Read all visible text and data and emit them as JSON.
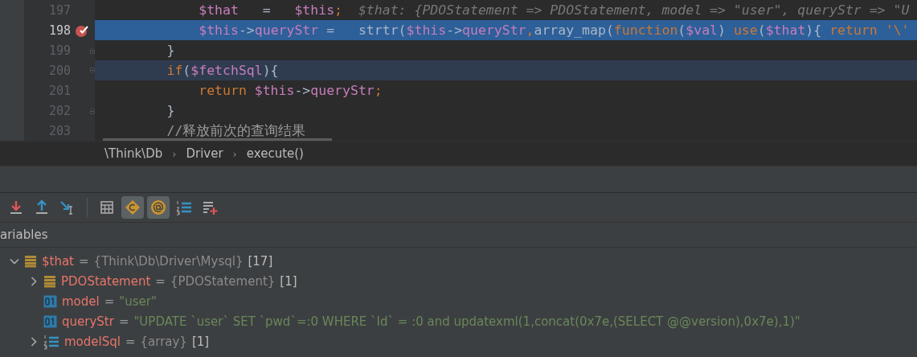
{
  "editor": {
    "lines": [
      {
        "number": "197",
        "executing": false,
        "caret_line": false,
        "breakpoint": false,
        "fold_open": false,
        "fold_close": false,
        "tokens": [
          {
            "kind": "var",
            "text": "            $that"
          },
          {
            "kind": "plain",
            "text": "   =   "
          },
          {
            "kind": "var",
            "text": "$this"
          },
          {
            "kind": "keyword",
            "text": ";  "
          },
          {
            "kind": "hint",
            "text": "$that: {PDOStatement => PDOStatement, model => \"user\", queryStr => \"U"
          }
        ]
      },
      {
        "number": "198",
        "executing": true,
        "caret_line": false,
        "breakpoint": true,
        "fold_open": false,
        "fold_close": false,
        "tokens": [
          {
            "kind": "var",
            "text": "            $this"
          },
          {
            "kind": "plain",
            "text": "->"
          },
          {
            "kind": "var",
            "text": "queryStr"
          },
          {
            "kind": "plain",
            "text": " =   strtr("
          },
          {
            "kind": "var",
            "text": "$this"
          },
          {
            "kind": "plain",
            "text": "->"
          },
          {
            "kind": "var",
            "text": "queryStr"
          },
          {
            "kind": "keyword",
            "text": ","
          },
          {
            "kind": "plain",
            "text": "array_map("
          },
          {
            "kind": "keyword",
            "text": "function"
          },
          {
            "kind": "plain",
            "text": "("
          },
          {
            "kind": "var",
            "text": "$val"
          },
          {
            "kind": "plain",
            "text": ") "
          },
          {
            "kind": "keyword",
            "text": "use"
          },
          {
            "kind": "plain",
            "text": "("
          },
          {
            "kind": "var",
            "text": "$that"
          },
          {
            "kind": "plain",
            "text": "){ "
          },
          {
            "kind": "keyword",
            "text": "return '\\'"
          }
        ]
      },
      {
        "number": "199",
        "executing": false,
        "caret_line": false,
        "breakpoint": false,
        "fold_open": false,
        "fold_close": true,
        "tokens": [
          {
            "kind": "plain",
            "text": "        }"
          }
        ]
      },
      {
        "number": "200",
        "executing": false,
        "caret_line": true,
        "breakpoint": false,
        "fold_open": true,
        "fold_close": false,
        "tokens": [
          {
            "kind": "keyword",
            "text": "        if"
          },
          {
            "kind": "plain",
            "text": "("
          },
          {
            "kind": "var",
            "text": "$fetchSql"
          },
          {
            "kind": "plain",
            "text": "){"
          }
        ]
      },
      {
        "number": "201",
        "executing": false,
        "caret_line": false,
        "breakpoint": false,
        "fold_open": false,
        "fold_close": false,
        "tokens": [
          {
            "kind": "keyword",
            "text": "            return "
          },
          {
            "kind": "var",
            "text": "$this"
          },
          {
            "kind": "plain",
            "text": "->"
          },
          {
            "kind": "var",
            "text": "queryStr"
          },
          {
            "kind": "keyword",
            "text": ";"
          }
        ]
      },
      {
        "number": "202",
        "executing": false,
        "caret_line": false,
        "breakpoint": false,
        "fold_open": false,
        "fold_close": true,
        "tokens": [
          {
            "kind": "plain",
            "text": "        }"
          }
        ]
      },
      {
        "number": "203",
        "executing": false,
        "caret_line": false,
        "breakpoint": false,
        "fold_open": false,
        "fold_close": false,
        "tokens": [
          {
            "kind": "comment",
            "text": "//释放前次的查询结果"
          }
        ]
      }
    ]
  },
  "breadcrumbs": [
    {
      "kind": "crumb",
      "text": "\\Think\\Db"
    },
    {
      "kind": "separator",
      "text": "›"
    },
    {
      "kind": "crumb",
      "text": "Driver"
    },
    {
      "kind": "separator",
      "text": "›"
    },
    {
      "kind": "crumb",
      "text": "execute()"
    }
  ],
  "toolbar": [
    {
      "kind": "step-into"
    },
    {
      "kind": "step-out"
    },
    {
      "kind": "run-to-cursor"
    },
    {
      "kind": "separator"
    },
    {
      "kind": "calculator"
    },
    {
      "kind": "constants",
      "on": true
    },
    {
      "kind": "at",
      "on": true
    },
    {
      "kind": "numbered-list"
    },
    {
      "kind": "add-list"
    }
  ],
  "variables": {
    "title": "ariables",
    "items": [
      {
        "kind": "object",
        "name": "$that",
        "equals": "=",
        "type": "{Think\\Db\\Driver\\Mysql}",
        "count": "[17]",
        "expanded": true,
        "children": [
          {
            "kind": "object",
            "name": "PDOStatement",
            "equals": "=",
            "type": "{PDOStatement}",
            "count": "[1]",
            "expanded": false
          },
          {
            "kind": "scalar",
            "name": "model",
            "equals": "=",
            "value": "\"user\""
          },
          {
            "kind": "scalar",
            "name": "queryStr",
            "equals": "=",
            "value": "\"UPDATE `user` SET `pwd`=:0 WHERE `Id` = :0 and updatexml(1,concat(0x7e,(SELECT @@version),0x7e),1)\""
          },
          {
            "kind": "array",
            "name": "modelSql",
            "equals": "=",
            "type": "{array}",
            "count": "[1]",
            "expanded": false
          }
        ]
      }
    ]
  }
}
